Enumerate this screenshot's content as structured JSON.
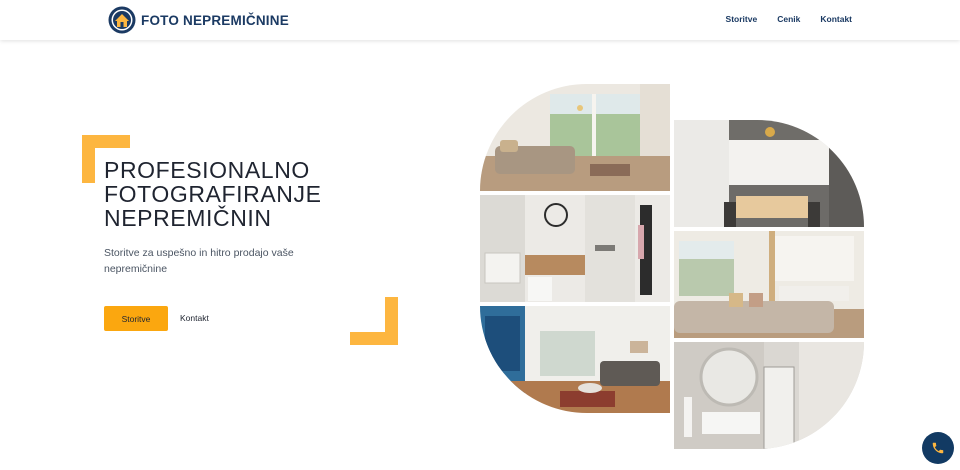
{
  "brand": {
    "name": "FOTO NEPREMIČNINE",
    "icon": "house-logo-icon",
    "primary_color": "#1b3a63",
    "accent_color": "#fdb640"
  },
  "nav": {
    "items": [
      {
        "label": "Storitve"
      },
      {
        "label": "Cenik"
      },
      {
        "label": "Kontakt"
      }
    ]
  },
  "hero": {
    "title": "PROFESIONALNO FOTOGRAFIRANJE NEPREMIČNIN",
    "subtitle": "Storitve za uspešno in hitro prodajo vaše nepremičnine",
    "primary_button": "Storitve",
    "secondary_link": "Kontakt",
    "button_color": "#fba70f"
  },
  "gallery": {
    "photos": [
      {
        "name": "living-room-with-terrace"
      },
      {
        "name": "bathroom-with-shower"
      },
      {
        "name": "living-room-blue-art"
      },
      {
        "name": "kitchen-with-dining-table"
      },
      {
        "name": "open-kitchen-living"
      },
      {
        "name": "bathroom-round-mirror"
      }
    ]
  },
  "floating": {
    "icon": "phone-icon"
  }
}
